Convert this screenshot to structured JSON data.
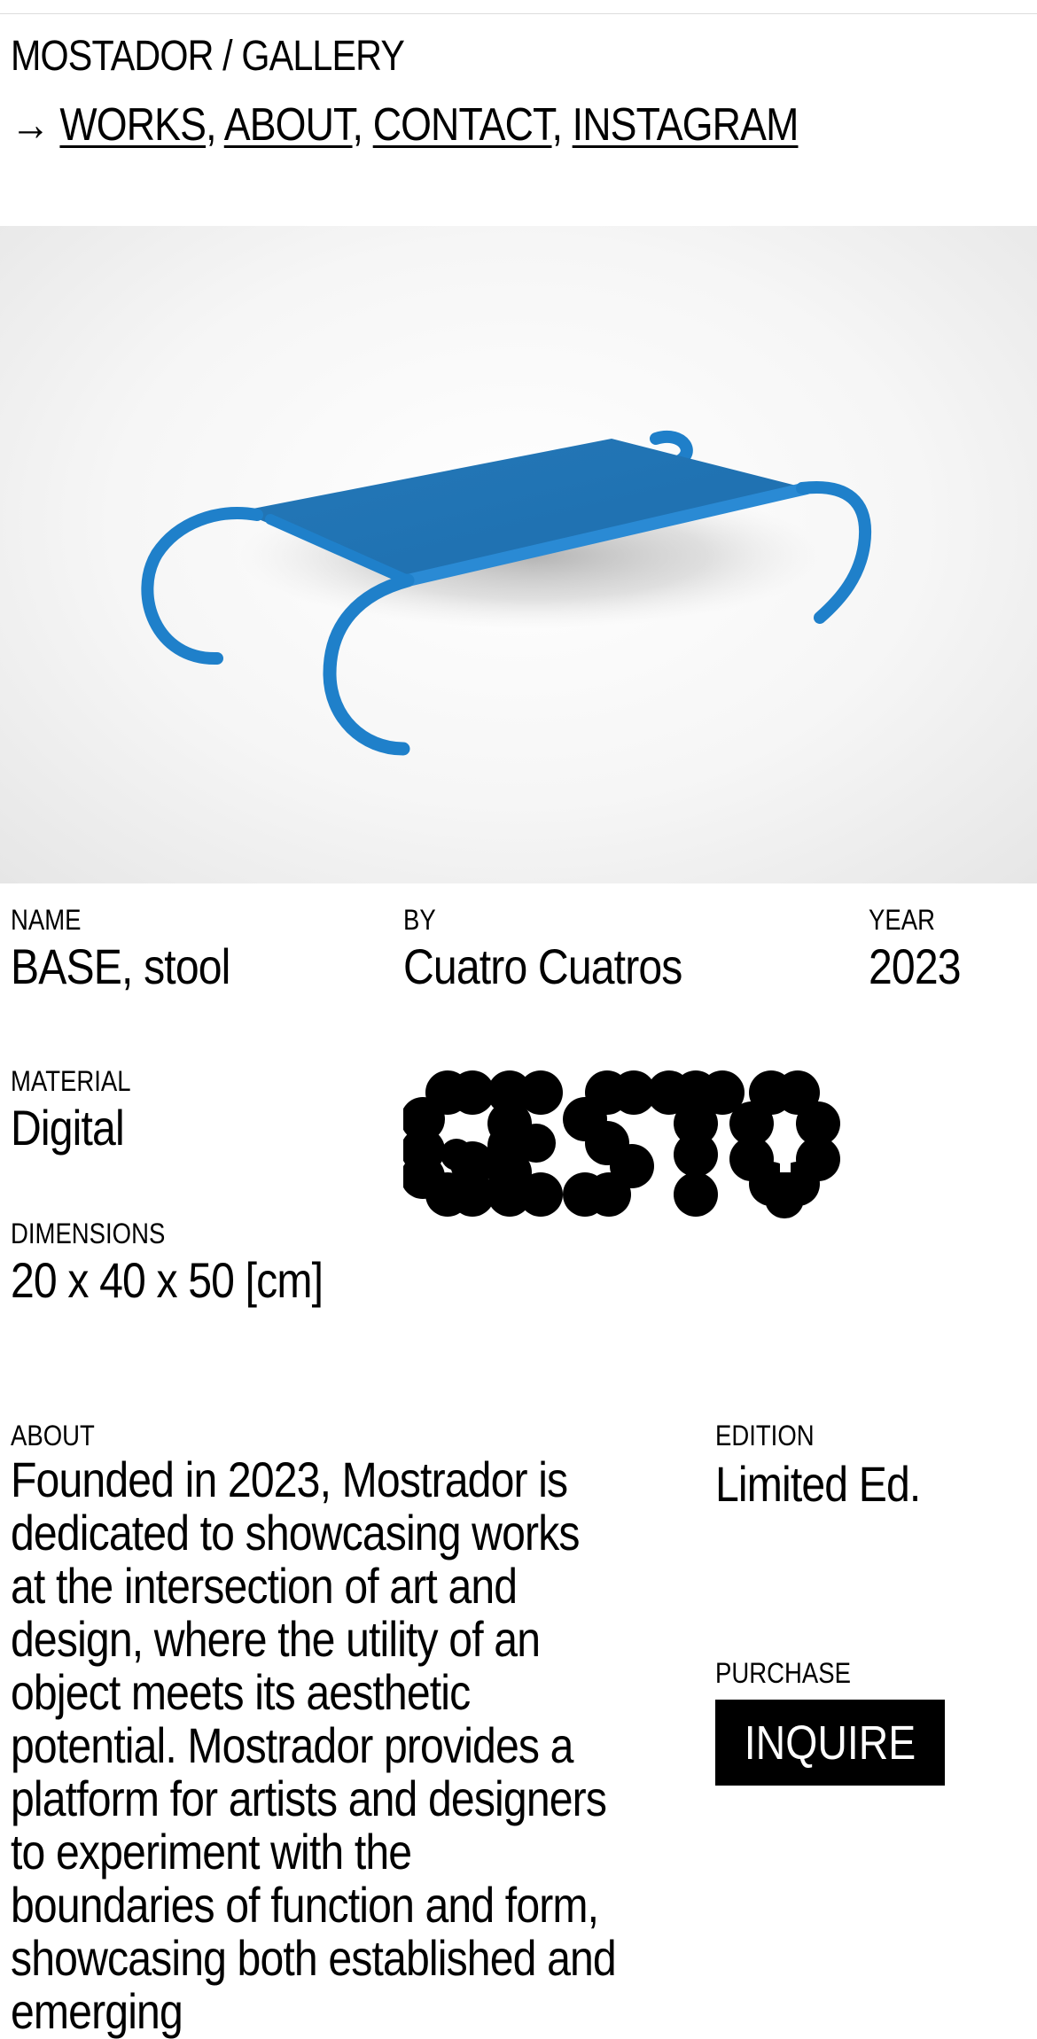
{
  "header": {
    "site_title": "MOSTADOR / GALLERY",
    "nav_arrow": "→",
    "nav_links": [
      "WORKS",
      "ABOUT",
      "CONTACT",
      "INSTAGRAM"
    ],
    "separator": ","
  },
  "work": {
    "name_label": "NAME",
    "name_value": "BASE, stool",
    "by_label": "BY",
    "by_value": "Cuatro Cuatros",
    "year_label": "YEAR",
    "year_value": "2023",
    "material_label": "MATERIAL",
    "material_value": "Digital",
    "dimensions_label": "DIMENSIONS",
    "dimensions_value": "20 x 40 x 50 [cm]",
    "logo_text": "GESTO"
  },
  "about": {
    "label": "ABOUT",
    "text": "Founded in 2023, Mostrador is dedicated to showcasing works at the intersection of art and design, where the utility of an object meets its aesthetic potential. Mostrador provides a platform for artists and designers to experiment with the boundaries of function and form, showcasing both established and emerging"
  },
  "edition": {
    "label": "EDITION",
    "value": "Limited Ed."
  },
  "purchase": {
    "label": "PURCHASE",
    "button_label": "INQUIRE"
  },
  "colors": {
    "product_blue": "#1f78c1",
    "button_bg": "#000000",
    "button_text": "#ffffff"
  }
}
